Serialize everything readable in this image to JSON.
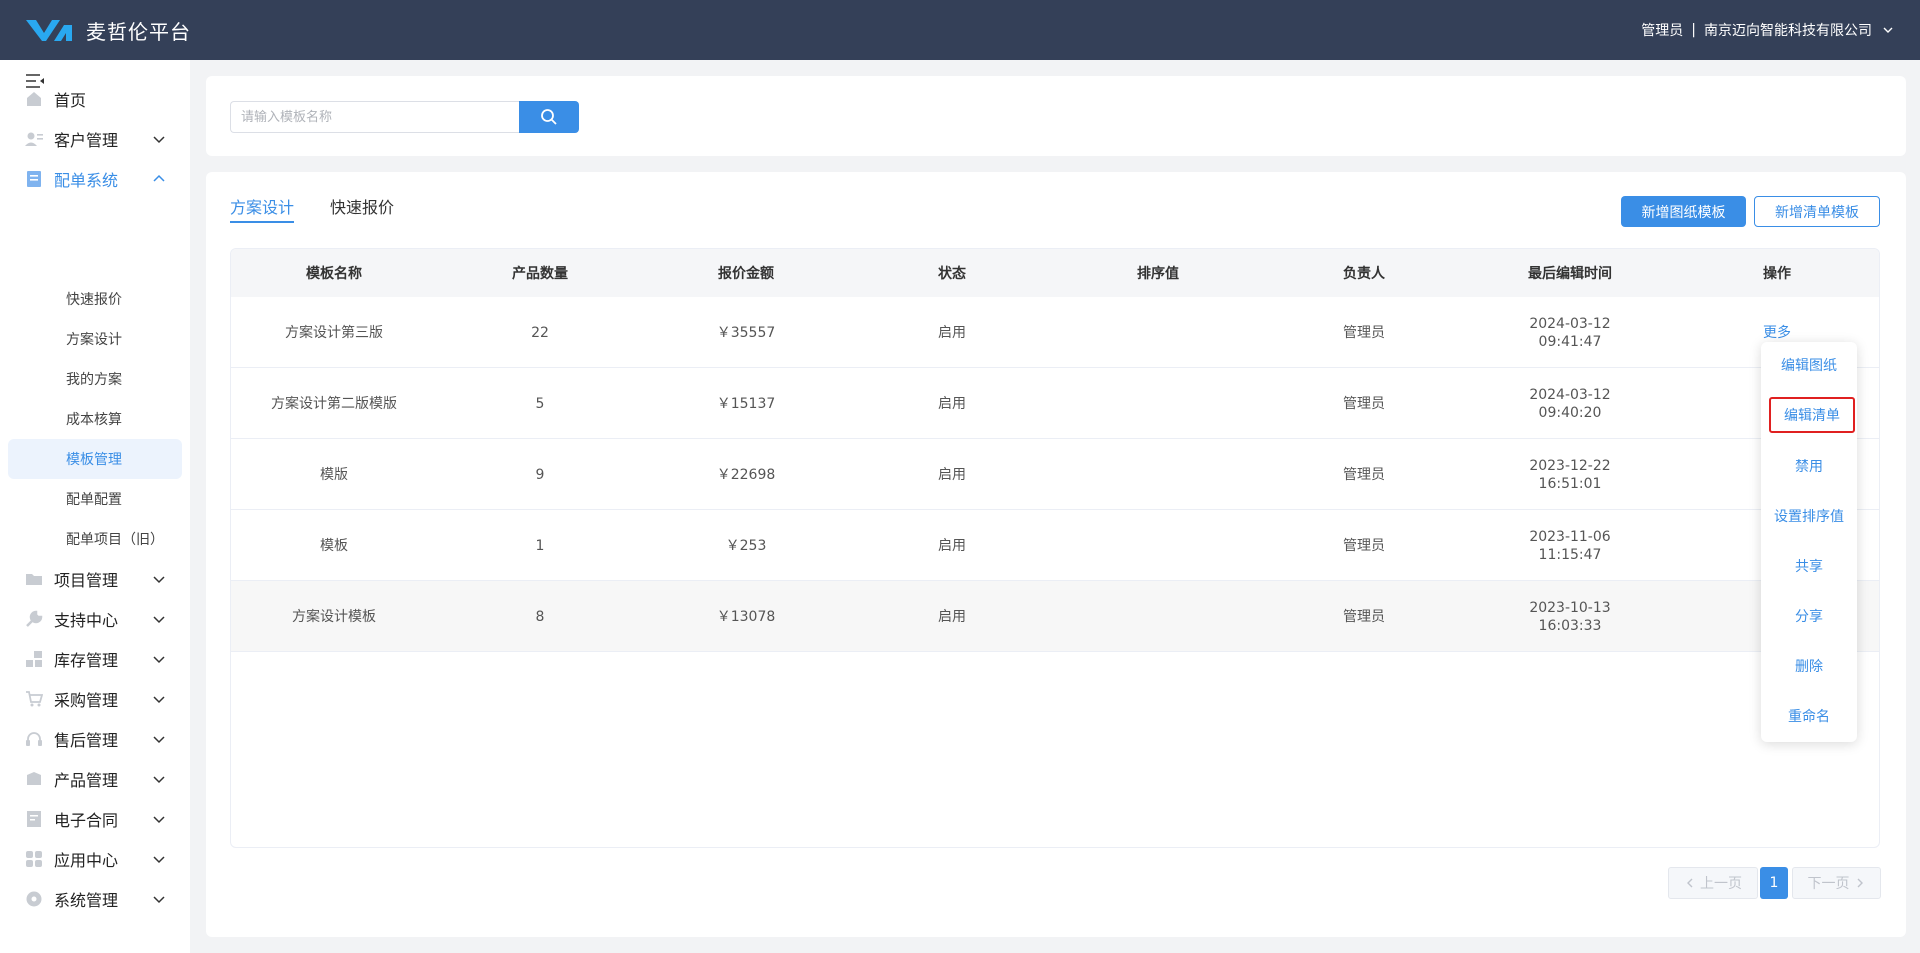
{
  "header": {
    "brand": "麦哲伦平台",
    "user_role": "管理员",
    "separator": "|",
    "company": "南京迈向智能科技有限公司"
  },
  "sidebar": {
    "items": [
      {
        "label": "首页",
        "icon": "home-icon"
      },
      {
        "label": "客户管理",
        "icon": "customer-icon"
      },
      {
        "label": "配单系统",
        "icon": "order-icon",
        "expanded": true
      },
      {
        "label": "项目管理",
        "icon": "folder-icon"
      },
      {
        "label": "支持中心",
        "icon": "wrench-icon"
      },
      {
        "label": "库存管理",
        "icon": "inventory-icon"
      },
      {
        "label": "采购管理",
        "icon": "cart-icon"
      },
      {
        "label": "售后管理",
        "icon": "headset-icon"
      },
      {
        "label": "产品管理",
        "icon": "box-icon"
      },
      {
        "label": "电子合同",
        "icon": "contract-icon"
      },
      {
        "label": "应用中心",
        "icon": "apps-icon"
      },
      {
        "label": "系统管理",
        "icon": "settings-icon"
      }
    ],
    "sub_items": [
      "快速报价",
      "方案设计",
      "我的方案",
      "成本核算",
      "模板管理",
      "配单配置",
      "配单项目（旧）"
    ],
    "selected_sub": "模板管理"
  },
  "search": {
    "placeholder": "请输入模板名称",
    "value": ""
  },
  "tabs": [
    "方案设计",
    "快速报价"
  ],
  "active_tab": "方案设计",
  "buttons": {
    "add_drawing_template": "新增图纸模板",
    "add_list_template": "新增清单模板"
  },
  "table": {
    "columns": [
      "模板名称",
      "产品数量",
      "报价金额",
      "状态",
      "排序值",
      "负责人",
      "最后编辑时间",
      "操作"
    ],
    "rows": [
      {
        "name": "方案设计第三版",
        "count": "22",
        "amount": "￥35557",
        "status": "启用",
        "sort": "",
        "owner": "管理员",
        "date": "2024-03-12",
        "time": "09:41:47",
        "action": "更多"
      },
      {
        "name": "方案设计第二版模版",
        "count": "5",
        "amount": "￥15137",
        "status": "启用",
        "sort": "",
        "owner": "管理员",
        "date": "2024-03-12",
        "time": "09:40:20",
        "action": ""
      },
      {
        "name": "模版",
        "count": "9",
        "amount": "￥22698",
        "status": "启用",
        "sort": "",
        "owner": "管理员",
        "date": "2023-12-22",
        "time": "16:51:01",
        "action": ""
      },
      {
        "name": "模板",
        "count": "1",
        "amount": "￥253",
        "status": "启用",
        "sort": "",
        "owner": "管理员",
        "date": "2023-11-06",
        "time": "11:15:47",
        "action": ""
      },
      {
        "name": "方案设计模板",
        "count": "8",
        "amount": "￥13078",
        "status": "启用",
        "sort": "",
        "owner": "管理员",
        "date": "2023-10-13",
        "time": "16:03:33",
        "action": ""
      }
    ]
  },
  "dropdown": {
    "items": [
      "编辑图纸",
      "编辑清单",
      "禁用",
      "设置排序值",
      "共享",
      "分享",
      "删除",
      "重命名"
    ],
    "highlighted": "编辑清单"
  },
  "pagination": {
    "prev": "上一页",
    "current": "1",
    "next": "下一页"
  },
  "colors": {
    "header_bg": "#344058",
    "accent": "#3a8ee6",
    "highlight_border": "#e02020"
  }
}
